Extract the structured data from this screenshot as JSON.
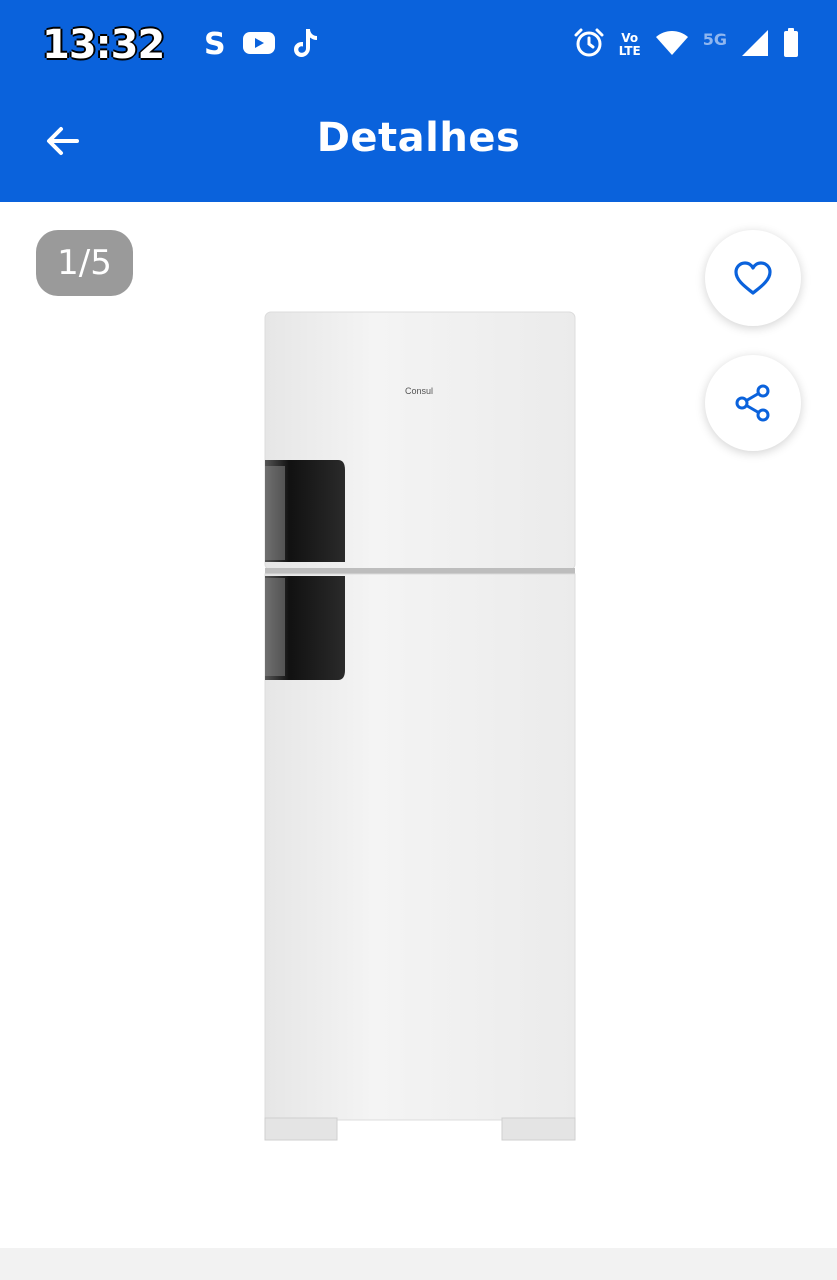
{
  "status_bar": {
    "time": "13:32",
    "left_icons": [
      "s-app-icon",
      "youtube-icon",
      "tiktok-icon"
    ],
    "s_app_glyph": "S",
    "right_icons": [
      "alarm-icon",
      "volte-icon",
      "wifi-icon",
      "5g-icon",
      "signal-icon",
      "battery-icon"
    ],
    "volte_top": "Vo",
    "volte_bottom": "LTE",
    "network": "5G"
  },
  "header": {
    "title": "Detalhes",
    "back_icon": "arrow-left-icon",
    "background_color": "#0a62dc"
  },
  "gallery": {
    "counter": "1/5",
    "brand_text": "Consul"
  },
  "actions": {
    "favorite_icon": "heart-icon",
    "share_icon": "share-icon",
    "icon_color": "#0a62dc"
  }
}
